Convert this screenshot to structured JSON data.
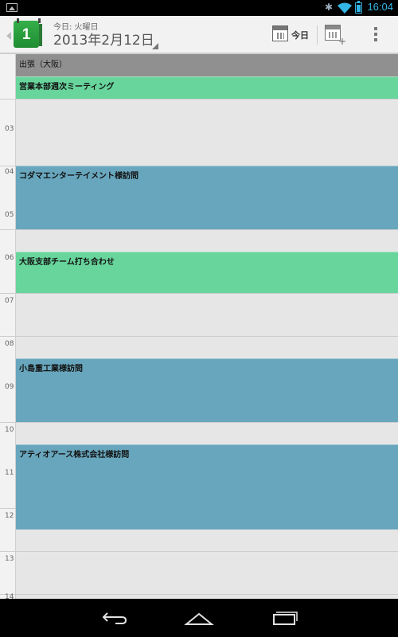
{
  "status": {
    "time": "16:04",
    "battery": "2"
  },
  "action_bar": {
    "subtitle": "今日: 火曜日",
    "date": "2013年2月12日",
    "app_icon_day": "1",
    "today_label": "今日",
    "icons": [
      "back-caret-icon",
      "calendar-app-icon",
      "today-calendar-icon",
      "new-event-icon",
      "overflow-menu-icon"
    ]
  },
  "hours": [
    "03",
    "04",
    "05",
    "06",
    "07",
    "08",
    "09",
    "10",
    "11",
    "12",
    "13",
    "14"
  ],
  "allday_event": {
    "title": "出張（大阪）",
    "color": "#909090"
  },
  "events": [
    {
      "title": "営業本部週次ミーティング",
      "color": "#68d59c"
    },
    {
      "title": "コダマエンターテイメント様訪問",
      "color": "#68a6bd"
    },
    {
      "title": "大阪支部チーム打ち合わせ",
      "color": "#68d59c"
    },
    {
      "title": "小島重工業様訪問",
      "color": "#68a6bd"
    },
    {
      "title": "アティオアース株式会社様訪問",
      "color": "#68a6bd"
    }
  ],
  "colors": {
    "accent": "#33b5e5",
    "green_event": "#68d59c",
    "blue_event": "#68a6bd"
  }
}
